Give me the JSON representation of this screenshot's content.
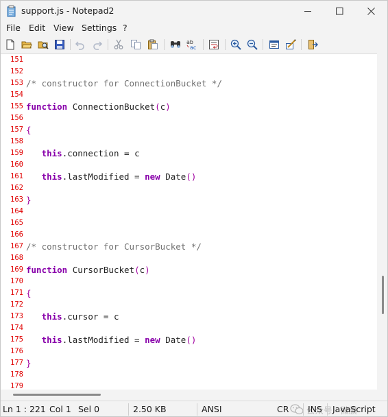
{
  "window": {
    "title": "support.js - Notepad2",
    "icon": "notepad-file-icon"
  },
  "menu": [
    "File",
    "Edit",
    "View",
    "Settings",
    "?"
  ],
  "toolbar": {
    "icons": [
      "new-file-icon",
      "open-folder-icon",
      "browse-icon",
      "save-icon",
      "undo-icon",
      "redo-icon",
      "cut-icon",
      "copy-icon",
      "paste-icon",
      "find-icon",
      "replace-icon",
      "word-wrap-icon",
      "zoom-in-icon",
      "zoom-out-icon",
      "scheme-icon",
      "customize-scheme-icon",
      "exit-icon"
    ]
  },
  "editor": {
    "lines": [
      {
        "n": "151",
        "code": ""
      },
      {
        "n": "152",
        "code": ""
      },
      {
        "n": "153",
        "code": "/* constructor for ConnectionBucket */"
      },
      {
        "n": "154",
        "code": ""
      },
      {
        "n": "155",
        "code": "function ConnectionBucket(c)"
      },
      {
        "n": "156",
        "code": ""
      },
      {
        "n": "157",
        "code": "{"
      },
      {
        "n": "158",
        "code": ""
      },
      {
        "n": "159",
        "code": "   this.connection = c"
      },
      {
        "n": "160",
        "code": ""
      },
      {
        "n": "161",
        "code": "   this.lastModified = new Date()"
      },
      {
        "n": "162",
        "code": ""
      },
      {
        "n": "163",
        "code": "}"
      },
      {
        "n": "164",
        "code": ""
      },
      {
        "n": "165",
        "code": ""
      },
      {
        "n": "166",
        "code": ""
      },
      {
        "n": "167",
        "code": "/* constructor for CursorBucket */"
      },
      {
        "n": "168",
        "code": ""
      },
      {
        "n": "169",
        "code": "function CursorBucket(c)"
      },
      {
        "n": "170",
        "code": ""
      },
      {
        "n": "171",
        "code": "{"
      },
      {
        "n": "172",
        "code": ""
      },
      {
        "n": "173",
        "code": "   this.cursor = c"
      },
      {
        "n": "174",
        "code": ""
      },
      {
        "n": "175",
        "code": "   this.lastModified = new Date()"
      },
      {
        "n": "176",
        "code": ""
      },
      {
        "n": "177",
        "code": "}"
      },
      {
        "n": "178",
        "code": ""
      },
      {
        "n": "179",
        "code": ""
      }
    ]
  },
  "statusbar": {
    "position": "Ln 1 : 221",
    "column": "Col 1",
    "selection": "Sel 0",
    "size": "2.50 KB",
    "encoding": "ANSI",
    "eol": "CR",
    "ins": "INS",
    "scheme": "JavaScript",
    "watermark": "公众号 · 微膜"
  }
}
